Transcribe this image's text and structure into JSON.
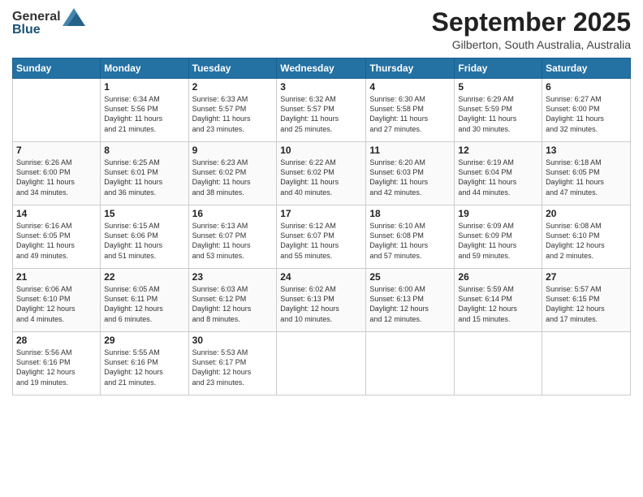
{
  "header": {
    "logo_general": "General",
    "logo_blue": "Blue",
    "month": "September 2025",
    "location": "Gilberton, South Australia, Australia"
  },
  "days_of_week": [
    "Sunday",
    "Monday",
    "Tuesday",
    "Wednesday",
    "Thursday",
    "Friday",
    "Saturday"
  ],
  "weeks": [
    [
      {
        "day": "",
        "content": ""
      },
      {
        "day": "1",
        "content": "Sunrise: 6:34 AM\nSunset: 5:56 PM\nDaylight: 11 hours\nand 21 minutes."
      },
      {
        "day": "2",
        "content": "Sunrise: 6:33 AM\nSunset: 5:57 PM\nDaylight: 11 hours\nand 23 minutes."
      },
      {
        "day": "3",
        "content": "Sunrise: 6:32 AM\nSunset: 5:57 PM\nDaylight: 11 hours\nand 25 minutes."
      },
      {
        "day": "4",
        "content": "Sunrise: 6:30 AM\nSunset: 5:58 PM\nDaylight: 11 hours\nand 27 minutes."
      },
      {
        "day": "5",
        "content": "Sunrise: 6:29 AM\nSunset: 5:59 PM\nDaylight: 11 hours\nand 30 minutes."
      },
      {
        "day": "6",
        "content": "Sunrise: 6:27 AM\nSunset: 6:00 PM\nDaylight: 11 hours\nand 32 minutes."
      }
    ],
    [
      {
        "day": "7",
        "content": "Sunrise: 6:26 AM\nSunset: 6:00 PM\nDaylight: 11 hours\nand 34 minutes."
      },
      {
        "day": "8",
        "content": "Sunrise: 6:25 AM\nSunset: 6:01 PM\nDaylight: 11 hours\nand 36 minutes."
      },
      {
        "day": "9",
        "content": "Sunrise: 6:23 AM\nSunset: 6:02 PM\nDaylight: 11 hours\nand 38 minutes."
      },
      {
        "day": "10",
        "content": "Sunrise: 6:22 AM\nSunset: 6:02 PM\nDaylight: 11 hours\nand 40 minutes."
      },
      {
        "day": "11",
        "content": "Sunrise: 6:20 AM\nSunset: 6:03 PM\nDaylight: 11 hours\nand 42 minutes."
      },
      {
        "day": "12",
        "content": "Sunrise: 6:19 AM\nSunset: 6:04 PM\nDaylight: 11 hours\nand 44 minutes."
      },
      {
        "day": "13",
        "content": "Sunrise: 6:18 AM\nSunset: 6:05 PM\nDaylight: 11 hours\nand 47 minutes."
      }
    ],
    [
      {
        "day": "14",
        "content": "Sunrise: 6:16 AM\nSunset: 6:05 PM\nDaylight: 11 hours\nand 49 minutes."
      },
      {
        "day": "15",
        "content": "Sunrise: 6:15 AM\nSunset: 6:06 PM\nDaylight: 11 hours\nand 51 minutes."
      },
      {
        "day": "16",
        "content": "Sunrise: 6:13 AM\nSunset: 6:07 PM\nDaylight: 11 hours\nand 53 minutes."
      },
      {
        "day": "17",
        "content": "Sunrise: 6:12 AM\nSunset: 6:07 PM\nDaylight: 11 hours\nand 55 minutes."
      },
      {
        "day": "18",
        "content": "Sunrise: 6:10 AM\nSunset: 6:08 PM\nDaylight: 11 hours\nand 57 minutes."
      },
      {
        "day": "19",
        "content": "Sunrise: 6:09 AM\nSunset: 6:09 PM\nDaylight: 11 hours\nand 59 minutes."
      },
      {
        "day": "20",
        "content": "Sunrise: 6:08 AM\nSunset: 6:10 PM\nDaylight: 12 hours\nand 2 minutes."
      }
    ],
    [
      {
        "day": "21",
        "content": "Sunrise: 6:06 AM\nSunset: 6:10 PM\nDaylight: 12 hours\nand 4 minutes."
      },
      {
        "day": "22",
        "content": "Sunrise: 6:05 AM\nSunset: 6:11 PM\nDaylight: 12 hours\nand 6 minutes."
      },
      {
        "day": "23",
        "content": "Sunrise: 6:03 AM\nSunset: 6:12 PM\nDaylight: 12 hours\nand 8 minutes."
      },
      {
        "day": "24",
        "content": "Sunrise: 6:02 AM\nSunset: 6:13 PM\nDaylight: 12 hours\nand 10 minutes."
      },
      {
        "day": "25",
        "content": "Sunrise: 6:00 AM\nSunset: 6:13 PM\nDaylight: 12 hours\nand 12 minutes."
      },
      {
        "day": "26",
        "content": "Sunrise: 5:59 AM\nSunset: 6:14 PM\nDaylight: 12 hours\nand 15 minutes."
      },
      {
        "day": "27",
        "content": "Sunrise: 5:57 AM\nSunset: 6:15 PM\nDaylight: 12 hours\nand 17 minutes."
      }
    ],
    [
      {
        "day": "28",
        "content": "Sunrise: 5:56 AM\nSunset: 6:16 PM\nDaylight: 12 hours\nand 19 minutes."
      },
      {
        "day": "29",
        "content": "Sunrise: 5:55 AM\nSunset: 6:16 PM\nDaylight: 12 hours\nand 21 minutes."
      },
      {
        "day": "30",
        "content": "Sunrise: 5:53 AM\nSunset: 6:17 PM\nDaylight: 12 hours\nand 23 minutes."
      },
      {
        "day": "",
        "content": ""
      },
      {
        "day": "",
        "content": ""
      },
      {
        "day": "",
        "content": ""
      },
      {
        "day": "",
        "content": ""
      }
    ]
  ]
}
